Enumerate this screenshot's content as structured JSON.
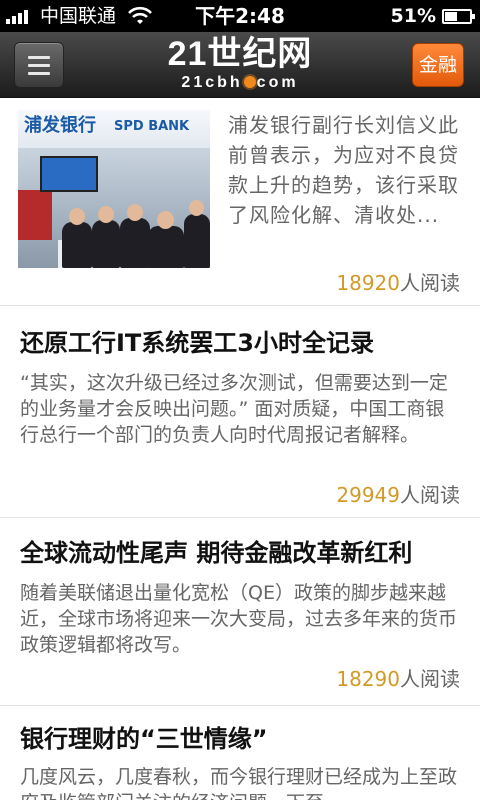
{
  "status_bar": {
    "carrier": "中国联通",
    "time": "下午2:48",
    "battery_percent": "51%",
    "battery_level": 0.51,
    "signal_bars": 4
  },
  "header": {
    "menu_icon": "hamburger-menu-icon",
    "logo_main": "21世纪网",
    "logo_sub_left": "21cbh",
    "logo_sub_right": "com",
    "finance_label": "金融",
    "colors": {
      "bar": "#2b2b2b",
      "accent": "#f06a1c"
    }
  },
  "articles": [
    {
      "image_sign_cn": "浦发银行",
      "image_sign_en": "SPD BANK",
      "summary": "浦发银行副行长刘信义此前曾表示，为应对不良贷款上升的趋势，该行采取了风险化解、清收处...",
      "read_count": "18920",
      "read_suffix": "人阅读"
    },
    {
      "title": "还原工行IT系统罢工3小时全记录",
      "summary": "“其实，这次升级已经过多次测试，但需要达到一定的业务量才会反映出问题。” 面对质疑，中国工商银行总行一个部门的负责人向时代周报记者解释。",
      "read_count": "29949",
      "read_suffix": "人阅读"
    },
    {
      "title": "全球流动性尾声 期待金融改革新红利",
      "summary": "随着美联储退出量化宽松（QE）政策的脚步越来越近，全球市场将迎来一次大变局，过去多年来的货币政策逻辑都将改写。",
      "read_count": "18290",
      "read_suffix": "人阅读"
    },
    {
      "title": "银行理财的“三世情缘”",
      "summary": "几度风云，几度春秋，而今银行理财已经成为上至政府及监管部门关注的经济问题，下至"
    }
  ],
  "colors": {
    "read_count": "#d29a28",
    "summary": "#666666",
    "title": "#111111"
  }
}
